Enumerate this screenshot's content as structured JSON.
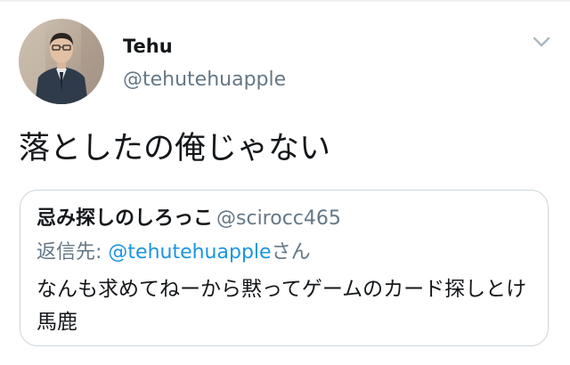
{
  "tweet": {
    "author": {
      "display_name": "Tehu",
      "handle": "@tehutehuapple"
    },
    "text": "落としたの俺じゃない",
    "menu_icon": "chevron-down-icon"
  },
  "quoted_tweet": {
    "author_name": "忌み探しのしろっこ",
    "author_handle": "@scirocc465",
    "reply_prefix": "返信先: ",
    "reply_mention": "@tehutehuapple",
    "reply_suffix": "さん",
    "text": "なんも求めてねーから黙ってゲームのカード探しとけ馬鹿"
  },
  "colors": {
    "text_primary": "#14171a",
    "text_secondary": "#657786",
    "mention": "#1b95e0",
    "border": "#ccd6dd"
  }
}
